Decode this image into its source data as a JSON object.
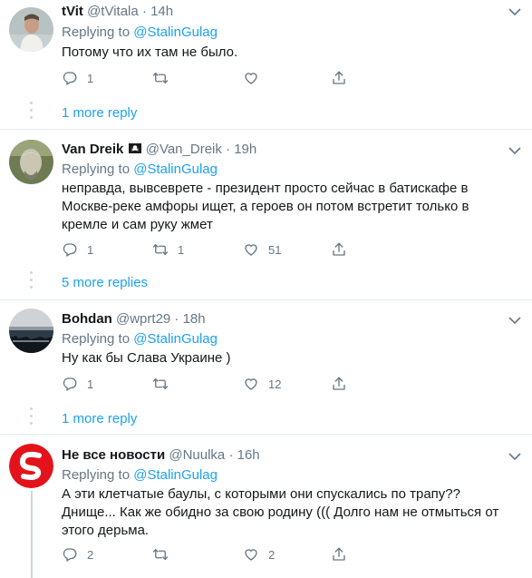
{
  "tweets": [
    {
      "name": "tVit",
      "handle": "@tVitala",
      "time": "14h",
      "reply_prefix": "Replying to ",
      "reply_mention": "@StalinGulag",
      "text": "Потому что их там не было.",
      "replies": "1",
      "retweets": "",
      "likes": "",
      "more_label": "1 more reply"
    },
    {
      "name": "Van Dreik",
      "name_emoji": "🏴‍☠️",
      "handle": "@Van_Dreik",
      "time": "19h",
      "reply_prefix": "Replying to ",
      "reply_mention": "@StalinGulag",
      "text_lines": [
        "неправда, вывсеврете - президент просто сейчас в батискафе в",
        "Москве-реке амфоры ищет, а героев он потом встретит только в",
        "кремле и сам руку жмет"
      ],
      "replies": "1",
      "retweets": "1",
      "likes": "51",
      "more_label": "5 more replies"
    },
    {
      "name": "Bohdan",
      "handle": "@wprt29",
      "time": "18h",
      "reply_prefix": "Replying to ",
      "reply_mention": "@StalinGulag",
      "text": "Ну как бы Слава Украине )",
      "replies": "1",
      "retweets": "",
      "likes": "12",
      "more_label": "1 more reply"
    },
    {
      "name": "Не все новости",
      "handle": "@Nuulka",
      "time": "16h",
      "reply_prefix": "Replying to ",
      "reply_mention": "@StalinGulag",
      "text_lines": [
        "А эти клетчатые баулы, с которыми они спускались по трапу??",
        "Днище... Как же обидно за свою родину ((( Долго нам не отмыться от",
        "этого дерьма."
      ],
      "replies": "2",
      "retweets": "",
      "likes": "2"
    }
  ],
  "dot_separator": "·",
  "colors": {
    "accent": "#1da1f2",
    "muted": "#657786",
    "divider": "#e6ecf0",
    "text": "#14171a"
  },
  "icons": [
    "reply-icon",
    "retweet-icon",
    "like-icon",
    "share-icon",
    "chevron-down-icon"
  ]
}
